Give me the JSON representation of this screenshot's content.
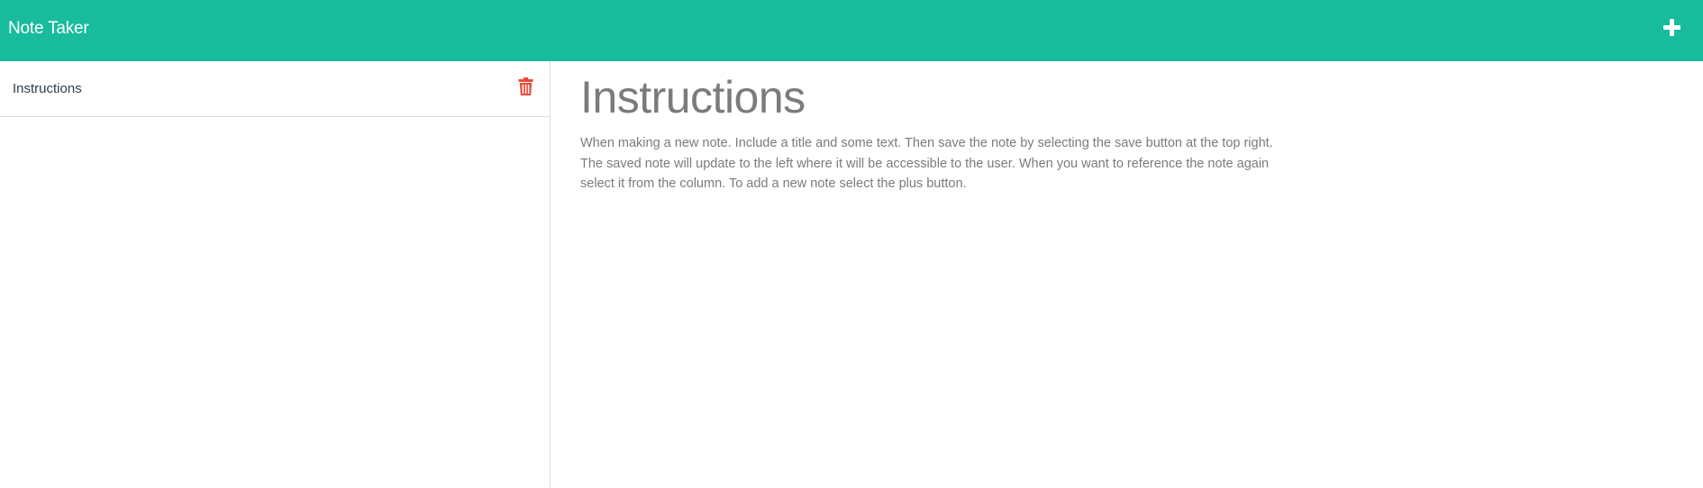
{
  "header": {
    "brand": "Note Taker",
    "add_icon": "plus-icon",
    "accent_color": "#18bc9c"
  },
  "sidebar": {
    "notes": [
      {
        "title": "Instructions",
        "delete_icon": "trash-icon"
      }
    ],
    "delete_color": "#e74c3c"
  },
  "main": {
    "title": "Instructions",
    "body": "When making a new note. Include a title and some text. Then save the note by selecting the save button at the top right. The saved note will update to the left where it will be accessible to the user. When you want to reference the note again select it from the column. To add a new note select the plus button."
  }
}
